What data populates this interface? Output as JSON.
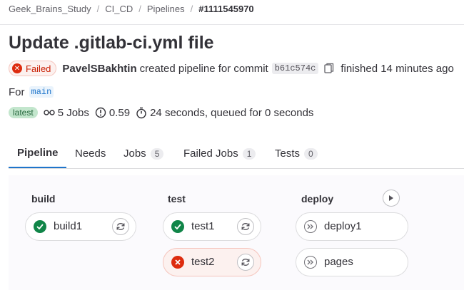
{
  "breadcrumb": {
    "items": [
      "Geek_Brains_Study",
      "CI_CD",
      "Pipelines"
    ],
    "current": "#1111545970"
  },
  "pipeline": {
    "title": "Update .gitlab-ci.yml file",
    "status_label": "Failed",
    "author": "PavelSBakhtin",
    "action_text": "created pipeline for commit",
    "commit_sha": "b61c574c",
    "finished_text": "finished 14 minutes ago",
    "for_label": "For",
    "branch": "main",
    "latest_badge": "latest",
    "jobs_summary": "5 Jobs",
    "coverage": "0.59",
    "duration_text": "24 seconds, queued for 0 seconds"
  },
  "tabs": [
    {
      "label": "Pipeline",
      "count": null,
      "active": true
    },
    {
      "label": "Needs",
      "count": null,
      "active": false
    },
    {
      "label": "Jobs",
      "count": "5",
      "active": false
    },
    {
      "label": "Failed Jobs",
      "count": "1",
      "active": false
    },
    {
      "label": "Tests",
      "count": "0",
      "active": false
    }
  ],
  "stages": [
    {
      "name": "build",
      "jobs": [
        {
          "name": "build1",
          "status": "success",
          "action": "retry"
        }
      ]
    },
    {
      "name": "test",
      "jobs": [
        {
          "name": "test1",
          "status": "success",
          "action": "retry"
        },
        {
          "name": "test2",
          "status": "failed",
          "action": "retry"
        }
      ]
    },
    {
      "name": "deploy",
      "jobs": [
        {
          "name": "deploy1",
          "status": "skipped"
        },
        {
          "name": "pages",
          "status": "skipped"
        }
      ]
    }
  ],
  "colors": {
    "success": "#108548",
    "failed": "#dd2b0e",
    "skipped": "#737278",
    "link": "#1f75cb"
  },
  "icons": {
    "copy": "copy-icon",
    "jobs": "pipeline-icon",
    "coverage": "coverage-icon",
    "duration": "timer-icon",
    "retry": "retry-icon",
    "play": "play-icon"
  }
}
